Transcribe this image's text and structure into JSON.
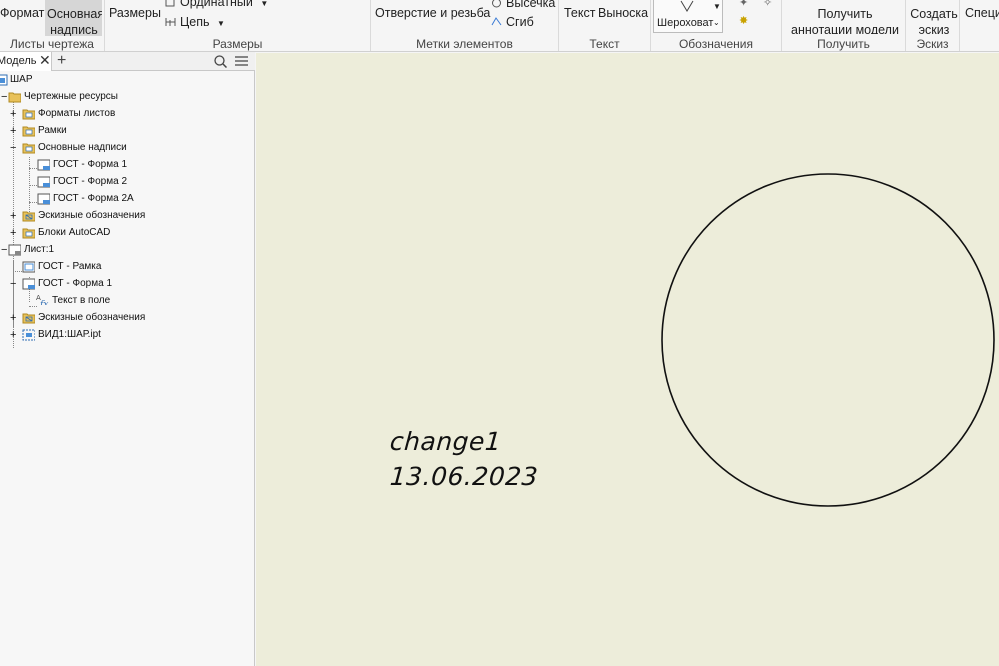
{
  "ribbon": {
    "format_label": "Формат",
    "title_block_label": "Основная надпись",
    "dimensions_label": "Размеры",
    "ordinate_label": "Ординатный",
    "chain_label": "Цепь",
    "hole_thread_label": "Отверстие и резьба",
    "cutout_label": "Высечка",
    "bend_label": "Сгиб",
    "text_label": "Текст",
    "leader_label": "Выноска",
    "roughness_label": "Шероховат",
    "retrieve_annotations_label": "Получить аннотации модели",
    "create_sketch_label": "Создать эскиз",
    "special_label": "Специ",
    "panels": {
      "sheets": "Листы чертежа",
      "dimensions": "Размеры",
      "feature_notes": "Метки элементов",
      "text": "Текст",
      "symbols": "Обозначения",
      "retrieve": "Получить",
      "sketch": "Эскиз"
    }
  },
  "browser": {
    "tab_label": "Модель",
    "tree": [
      {
        "label": "ШАР",
        "icon": "drawing-icon"
      },
      {
        "label": "Чертежные ресурсы",
        "icon": "folder-icon"
      },
      {
        "label": "Форматы листов",
        "icon": "folder-icon"
      },
      {
        "label": "Рамки",
        "icon": "folder-icon"
      },
      {
        "label": "Основные надписи",
        "icon": "folder-icon"
      },
      {
        "label": "ГОСТ - Форма 1",
        "icon": "title-block-icon"
      },
      {
        "label": "ГОСТ - Форма 2",
        "icon": "title-block-icon"
      },
      {
        "label": "ГОСТ - Форма 2А",
        "icon": "title-block-icon"
      },
      {
        "label": "Эскизные обозначения",
        "icon": "sketch-symbol-icon"
      },
      {
        "label": "Блоки AutoCAD",
        "icon": "folder-icon"
      },
      {
        "label": "Лист:1",
        "icon": "sheet-icon"
      },
      {
        "label": "ГОСТ - Рамка",
        "icon": "border-icon"
      },
      {
        "label": "ГОСТ - Форма 1",
        "icon": "title-block-icon"
      },
      {
        "label": "Текст в поле",
        "icon": "text-field-icon"
      },
      {
        "label": "Эскизные обозначения",
        "icon": "sketch-symbol-icon"
      },
      {
        "label": "ВИД1:ШАР.ipt",
        "icon": "view-icon"
      }
    ]
  },
  "canvas": {
    "text_line1": "change1",
    "text_line2": "13.06.2023"
  },
  "colors": {
    "canvas_bg": "#ededda",
    "ribbon_bg": "#f5f5f5",
    "folder": "#e8c15a"
  }
}
